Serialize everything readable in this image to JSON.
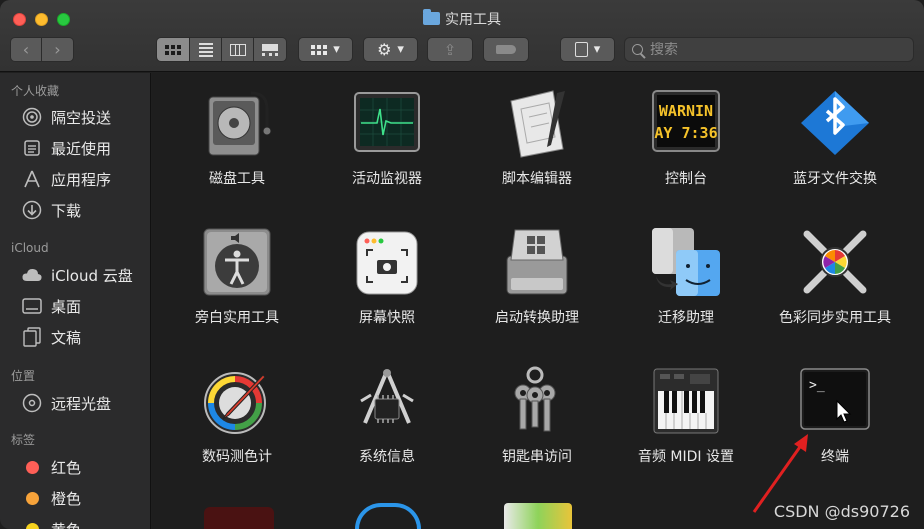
{
  "window": {
    "title": "实用工具"
  },
  "toolbar": {
    "view_modes": [
      "icon-view",
      "list-view",
      "column-view",
      "gallery-view"
    ],
    "group_label": "▾",
    "action_label": "▾",
    "tag_label": "▾"
  },
  "search": {
    "placeholder": "搜索"
  },
  "sidebar": {
    "favorites_header": "个人收藏",
    "favorites": [
      {
        "label": "隔空投送",
        "icon": "airdrop-icon"
      },
      {
        "label": "最近使用",
        "icon": "recents-icon"
      },
      {
        "label": "应用程序",
        "icon": "applications-icon"
      },
      {
        "label": "下载",
        "icon": "downloads-icon"
      }
    ],
    "icloud_header": "iCloud",
    "icloud": [
      {
        "label": "iCloud 云盘",
        "icon": "cloud-icon"
      },
      {
        "label": "桌面",
        "icon": "desktop-icon"
      },
      {
        "label": "文稿",
        "icon": "documents-icon"
      }
    ],
    "locations_header": "位置",
    "locations": [
      {
        "label": "远程光盘",
        "icon": "disc-icon"
      }
    ],
    "tags_header": "标签",
    "tags": [
      {
        "label": "红色",
        "color": "#fe5f57"
      },
      {
        "label": "橙色",
        "color": "#f7a33a"
      },
      {
        "label": "黄色",
        "color": "#f5d21e"
      }
    ]
  },
  "apps": [
    {
      "label": "磁盘工具",
      "icon": "disk-utility-icon"
    },
    {
      "label": "活动监视器",
      "icon": "activity-monitor-icon"
    },
    {
      "label": "脚本编辑器",
      "icon": "script-editor-icon"
    },
    {
      "label": "控制台",
      "icon": "console-icon",
      "screen_text": [
        "WARNIN",
        "AY 7:36"
      ]
    },
    {
      "label": "蓝牙文件交换",
      "icon": "bluetooth-icon"
    },
    {
      "label": "旁白实用工具",
      "icon": "voiceover-icon"
    },
    {
      "label": "屏幕快照",
      "icon": "screenshot-icon"
    },
    {
      "label": "启动转换助理",
      "icon": "bootcamp-icon"
    },
    {
      "label": "迁移助理",
      "icon": "migration-icon"
    },
    {
      "label": "色彩同步实用工具",
      "icon": "colorsync-icon"
    },
    {
      "label": "数码测色计",
      "icon": "color-meter-icon"
    },
    {
      "label": "系统信息",
      "icon": "system-info-icon"
    },
    {
      "label": "钥匙串访问",
      "icon": "keychain-icon"
    },
    {
      "label": "音频 MIDI 设置",
      "icon": "midi-icon"
    },
    {
      "label": "终端",
      "icon": "terminal-icon",
      "screen_text": ">_"
    }
  ],
  "watermark": "CSDN @ds90726",
  "colors": {
    "annotation_arrow": "#e02020",
    "window_bg": "#1e1e1e"
  }
}
